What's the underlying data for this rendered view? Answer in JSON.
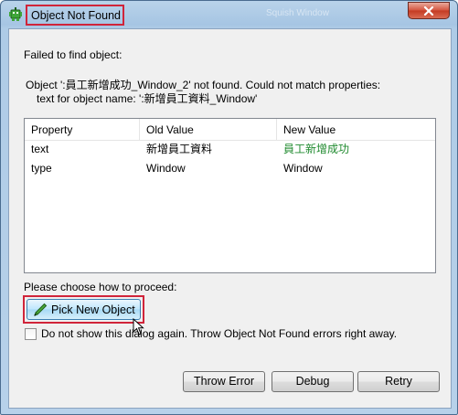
{
  "window": {
    "title": "Object Not Found",
    "ghost_title": "Squish Window"
  },
  "message": {
    "failed": "Failed to find object:",
    "detail_line1": "Object ':員工新增成功_Window_2' not found. Could not match properties:",
    "detail_line2": "text for object name: ':新增員工資料_Window'"
  },
  "table": {
    "headers": [
      "Property",
      "Old Value",
      "New Value"
    ],
    "rows": [
      [
        "text",
        "新增員工資料",
        "員工新增成功"
      ],
      [
        "type",
        "Window",
        "Window"
      ]
    ]
  },
  "proceed": {
    "prompt": "Please choose how to proceed:",
    "pick_label": "Pick New Object",
    "checkbox_label": "Do not show this dialog again. Throw Object Not Found errors right away.",
    "checkbox_checked": false
  },
  "buttons": {
    "throw": "Throw Error",
    "debug": "Debug",
    "retry": "Retry"
  },
  "colors": {
    "highlight": "#d0243a",
    "new_value": "#1f8a2e"
  },
  "icons": {
    "app": "squish-bot-icon",
    "pick": "pen-icon",
    "cursor": "mouse-cursor-icon",
    "close": "close-icon"
  }
}
